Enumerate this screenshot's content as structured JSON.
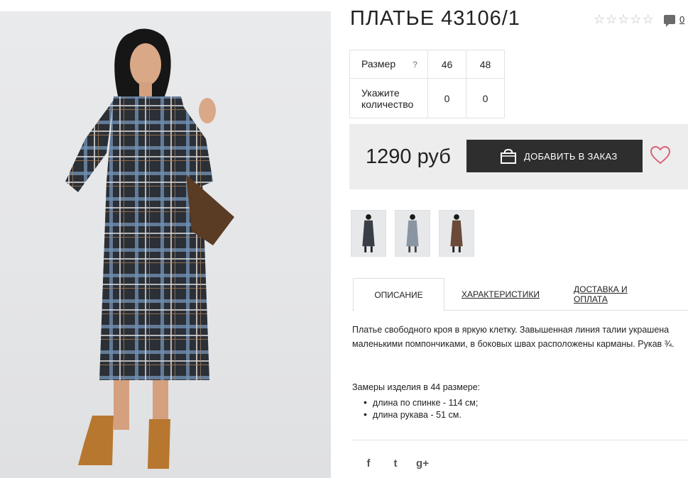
{
  "product": {
    "title": "ПЛАТЬЕ 43106/1",
    "rating_stars": 0,
    "rating_max": 5,
    "comment_count": "0",
    "price": "1290 руб",
    "add_to_cart_label": "ДОБАВИТЬ В ЗАКАЗ"
  },
  "size_table": {
    "size_label": "Размер",
    "help_mark": "?",
    "qty_label": "Укажите количество",
    "sizes": [
      "46",
      "48"
    ],
    "quantities": [
      "0",
      "0"
    ]
  },
  "tabs": [
    {
      "label": "ОПИСАНИЕ",
      "active": true
    },
    {
      "label": "ХАРАКТЕРИСТИКИ",
      "active": false
    },
    {
      "label": "ДОСТАВКА И ОПЛАТА",
      "active": false
    }
  ],
  "description": {
    "text": "Платье свободного кроя в яркую клетку. Завышенная линия талии украшена маленькими помпончиками, в боковых швах расположены карманы. Рукав ¾.",
    "measure_title": "Замеры изделия в 44 размере:",
    "measures": [
      "длина по спинке - 114 см;",
      "длина рукава - 51 см."
    ]
  },
  "social": [
    {
      "icon": "facebook-icon",
      "glyph": "f"
    },
    {
      "icon": "twitter-icon",
      "glyph": "t"
    },
    {
      "icon": "google-plus-icon",
      "glyph": "g+"
    }
  ],
  "colors": {
    "button_bg": "#2e2e2e",
    "buy_box_bg": "#ededed",
    "heart": "#d9627a",
    "star_empty": "#bdbdbd"
  }
}
